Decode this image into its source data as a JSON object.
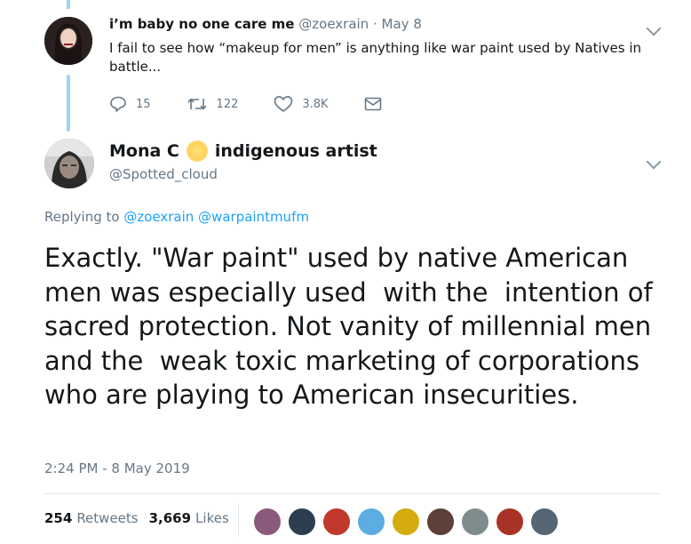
{
  "tweet1": {
    "name": "i’m baby no one care me",
    "handle": "@zoexrain",
    "separator": "·",
    "date": "May 8",
    "text": "I fail to see how “makeup for men” is anything like war paint used by Natives in battle...",
    "actions": {
      "reply_count": "15",
      "retweet_count": "122",
      "like_count": "3.8K"
    }
  },
  "tweet2": {
    "name": "Mona C",
    "bio_emoji_icon": "sun-icon",
    "name_suffix": "indigenous artist",
    "handle": "@Spotted_cloud",
    "replying_prefix": "Replying to",
    "replying_to": "@zoexrain @warpaintmufm",
    "text": "Exactly. \"War paint\" used by native American men was especially used  with the  intention of sacred protection. Not vanity of millennial men and the  weak toxic marketing of corporations who are playing to American insecurities.",
    "timestamp": "2:24 PM - 8 May 2019",
    "retweets_count": "254",
    "retweets_label": "Retweets",
    "likes_count": "3,669",
    "likes_label": "Likes"
  },
  "colors": {
    "link": "#1da1f2",
    "thread_line": "#9dd3f5",
    "muted": "#657786"
  },
  "liker_avatar_colors": [
    "#8a5a7a",
    "#2c3e50",
    "#c0392b",
    "#5dade2",
    "#d4ac0d",
    "#5d4037",
    "#7f8c8d",
    "#a93226",
    "#566573"
  ]
}
